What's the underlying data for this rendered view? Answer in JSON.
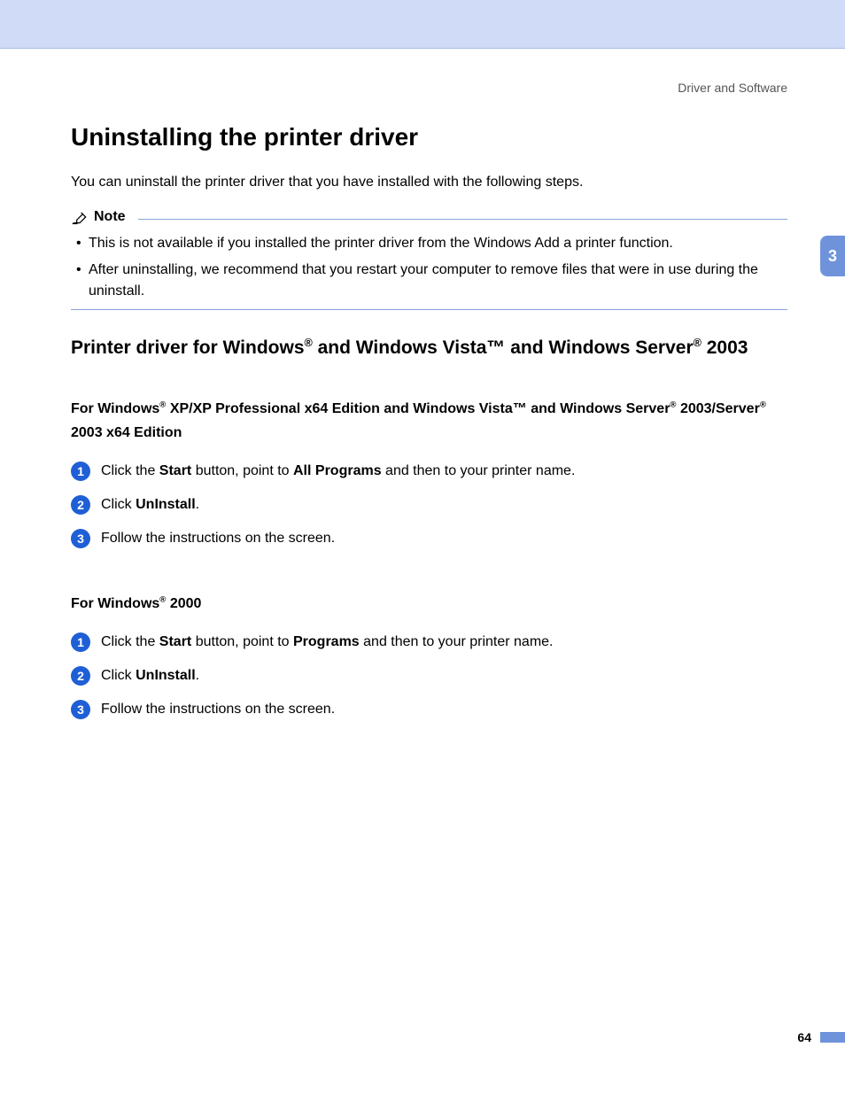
{
  "header": {
    "section_label": "Driver and Software"
  },
  "side_tab": "3",
  "page_number": "64",
  "title": "Uninstalling the printer driver",
  "intro": "You can uninstall the printer driver that you have installed with the following steps.",
  "note": {
    "label": "Note",
    "items": [
      "This is not available if you installed the printer driver from the Windows Add a printer function.",
      "After uninstalling, we recommend that you restart your computer to remove files that were in use during the uninstall."
    ]
  },
  "h2": {
    "p1": "Printer driver for Windows",
    "p2": " and Windows Vista™ and Windows Server",
    "p3": " 2003",
    "reg": "®"
  },
  "sectionA": {
    "heading": {
      "p1": "For Windows",
      "p2": " XP/XP Professional x64 Edition and Windows Vista™ and Windows Server",
      "p3": " 2003/Server",
      "p4": " 2003 x64 Edition",
      "reg": "®"
    },
    "steps": [
      {
        "pre": "Click the ",
        "b1": "Start",
        "mid": " button, point to ",
        "b2": "All Programs",
        "post": " and then to your printer name."
      },
      {
        "pre": "Click ",
        "b1": "UnInstall",
        "mid": ".",
        "b2": "",
        "post": ""
      },
      {
        "pre": "Follow the instructions on the screen.",
        "b1": "",
        "mid": "",
        "b2": "",
        "post": ""
      }
    ]
  },
  "sectionB": {
    "heading": {
      "p1": "For Windows",
      "p2": " 2000",
      "reg": "®"
    },
    "steps": [
      {
        "pre": "Click the ",
        "b1": "Start",
        "mid": " button, point to ",
        "b2": "Programs",
        "post": " and then to your printer name."
      },
      {
        "pre": "Click ",
        "b1": "UnInstall",
        "mid": ".",
        "b2": "",
        "post": ""
      },
      {
        "pre": "Follow the instructions on the screen.",
        "b1": "",
        "mid": "",
        "b2": "",
        "post": ""
      }
    ]
  }
}
